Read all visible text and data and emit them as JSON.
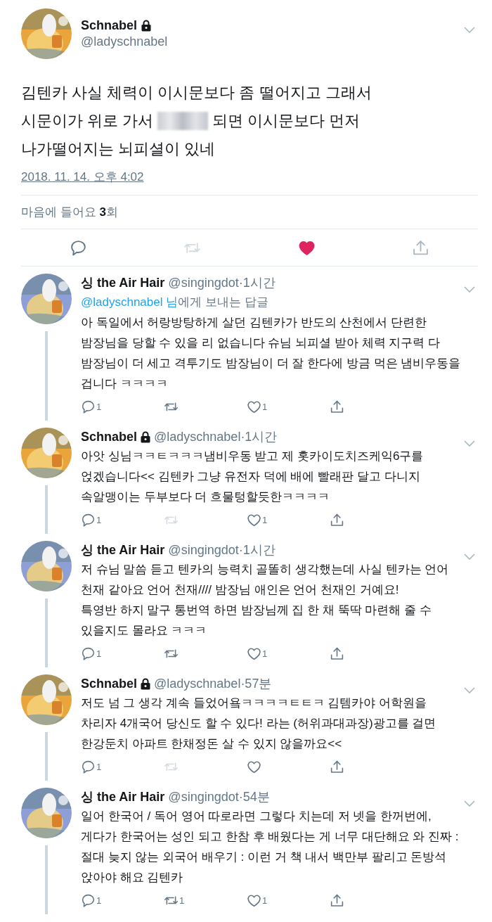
{
  "tweet": {
    "author": {
      "name": "Schnabel",
      "protected": true,
      "handle": "@ladyschnabel"
    },
    "body": [
      [
        {
          "kind": "text",
          "text": "김텐카 사실 체력이 이시문보다 좀 떨어지고 그래서"
        }
      ],
      [
        {
          "kind": "text",
          "text": "시문이가 위로 가서"
        },
        {
          "kind": "redaction"
        },
        {
          "kind": "text",
          "text": "되면 이시문보다 먼저"
        }
      ],
      [
        {
          "kind": "text",
          "text": "나가떨어지는 뇌피셜이 있네"
        }
      ]
    ],
    "timestamp": "2018. 11. 14. 오후 4:02",
    "likes_summary": "마음에 들어요 **3**회",
    "actions": {
      "liked": true,
      "retweet_disabled": true
    }
  },
  "replies": [
    {
      "name": "싱 the Air Hair",
      "protected": false,
      "handle": "@singingdot",
      "separator": "·",
      "time": "1시간",
      "reply_to": {
        "mention": "@ladyschnabel 님",
        "text": "에게 보내는 답글"
      },
      "text": "아 독일에서 허랑방탕하게 살던 김텐카가 반도의 산천에서 단련한\n밤장님을 당할 수 있을 리 없습니다 슈님 뇌피셜 받아 체력 지구력 다\n밤장님이 더 세고 격투기도 밤장님이 더 잘 한다에 방금 먹은 냄비우동을\n겁니다 ㅋㅋㅋㅋ",
      "reply_count": "1",
      "retweet_disabled": false,
      "like_count": "1",
      "liked": false
    },
    {
      "name": "Schnabel",
      "protected": true,
      "handle": "@ladyschnabel",
      "separator": "·",
      "time": "1시간",
      "text": "아앗 싱님ㅋㅋㅌㅋㅋㅋ냄비우동 받고 제 홋카이도치즈케익6구를\n얹겠습니다<< 김텐카 그냥 유전자 덕에 배에 빨래판 달고 다니지\n속알맹이는 두부보다 더 흐물텅할듯한ㅋㅋㅋㅋ",
      "reply_count": "1",
      "retweet_disabled": true,
      "like_count": "1",
      "liked": false
    },
    {
      "name": "싱 the Air Hair",
      "protected": false,
      "handle": "@singingdot",
      "separator": "·",
      "time": "1시간",
      "text": "저 슈님 말씀 듣고 텐카의 능력치 골똘히 생각했는데 사실 텐카는 언어\n천재 같아요 언어 천재//// 밤장님 애인은 언어 천재인 거예요!\n특영반 하지 말구 통번역 하면 밤장님께 집 한 채 뚝딱 마련해 줄 수\n있을지도 몰라요 ㅋㅋㅋ",
      "reply_count": "1",
      "retweet_disabled": false,
      "like_count": "1",
      "liked": false
    },
    {
      "name": "Schnabel",
      "protected": true,
      "handle": "@ladyschnabel",
      "separator": "·",
      "time": "57분",
      "text": "저도 넘 그 생각 계속 들었어욬ㅋㅋㅋㅋㅌㅌㅋ 김템카야 어학원을\n차리자 4개국어 당신도 할 수 있다! 라는 (허위과대과장)광고를 걸면\n한강둔치 아파트 한채정돈 살 수 있지 않을까요<<",
      "reply_count": "1",
      "retweet_disabled": true,
      "liked": false
    },
    {
      "name": "싱 the Air Hair",
      "protected": false,
      "handle": "@singingdot",
      "separator": "·",
      "time": "54분",
      "text": "일어 한국어 / 독어 영어 따로라면 그렇다 치는데 저 넷을 한꺼번에,\n게다가 한국어는 성인 되고 한참 후 배웠다는 게 너무 대단해요 와 진짜 :\n절대 늦지 않는 외국어 배우기 : 이런 거 책 내서 백만부 팔리고 돈방석\n앉아야 해요 김텐카",
      "reply_count": "1",
      "retweet_count": "1",
      "retweet_disabled": false,
      "like_count": "1",
      "liked": false
    }
  ]
}
